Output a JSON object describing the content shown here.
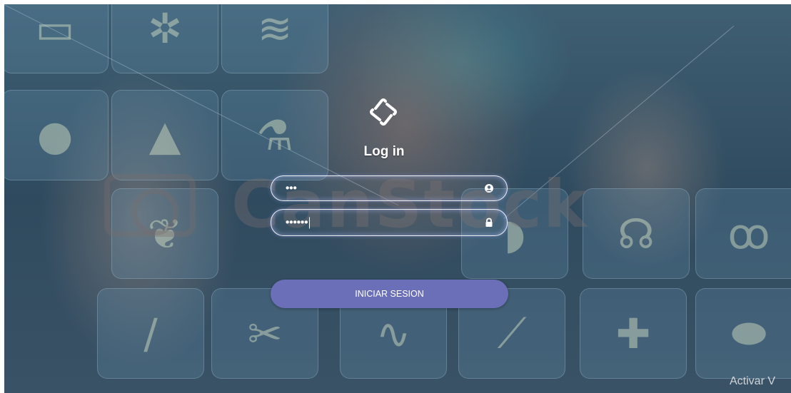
{
  "login": {
    "title": "Log in",
    "username_value": "•••",
    "password_value": "••••••",
    "submit_label": "INICIAR SESION"
  },
  "background": {
    "watermark_text": "CanStock",
    "activation_notice": "Activar V"
  },
  "icons": {
    "logo": "brand-logo-icon",
    "user_field": "user-circle-icon",
    "password_field": "lock-icon"
  },
  "colors": {
    "button": "#6b6fb8",
    "field_border": "#ffffff",
    "title": "#ffffff"
  }
}
